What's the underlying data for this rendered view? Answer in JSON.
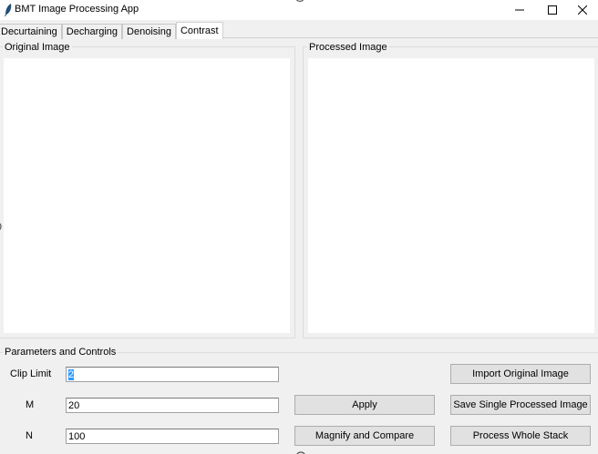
{
  "window": {
    "title": "BMT Image Processing App",
    "minimize_glyph": "—",
    "maximize_glyph": "☐",
    "close_glyph": "✕"
  },
  "tabs": [
    {
      "label": "Decurtaining",
      "active": false
    },
    {
      "label": "Decharging",
      "active": false
    },
    {
      "label": "Denoising",
      "active": false
    },
    {
      "label": "Contrast",
      "active": true
    }
  ],
  "panels": {
    "original_label": "Original Image",
    "processed_label": "Processed Image"
  },
  "params": {
    "section_label": "Parameters and Controls",
    "clip_limit": {
      "label": "Clip Limit",
      "value": "2"
    },
    "m": {
      "label": "M",
      "value": "20"
    },
    "n": {
      "label": "N",
      "value": "100"
    }
  },
  "buttons": {
    "apply": "Apply",
    "magnify": "Magnify and Compare",
    "import": "Import Original Image",
    "save_single": "Save Single Processed Image",
    "process_stack": "Process Whole Stack"
  },
  "colors": {
    "window_bg": "#f0f0f0",
    "canvas_bg": "#ffffff",
    "button_bg": "#e1e1e1",
    "selection": "#3399ff"
  }
}
